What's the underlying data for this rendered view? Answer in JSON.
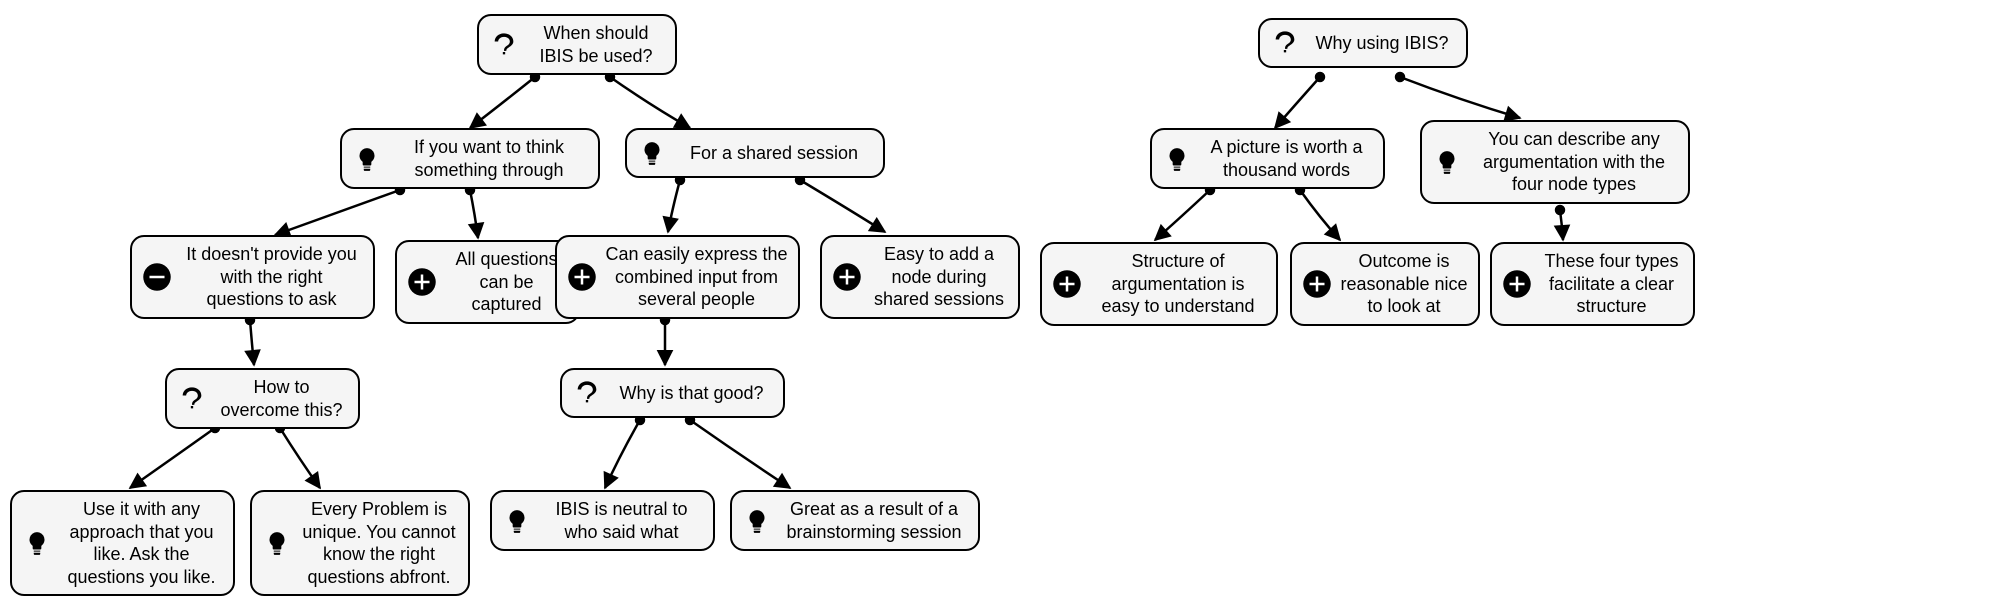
{
  "icons": {
    "question": "question-icon",
    "idea": "lightbulb-icon",
    "plus": "plus-icon",
    "minus": "minus-icon"
  },
  "nodes": {
    "q_when": {
      "icon": "question",
      "text": "When should IBIS be used?"
    },
    "i_think": {
      "icon": "idea",
      "text": "If you want to think something through"
    },
    "i_shared": {
      "icon": "idea",
      "text": "For a shared session"
    },
    "m_noq": {
      "icon": "minus",
      "text": "It doesn't provide you with the right questions to ask"
    },
    "p_allq": {
      "icon": "plus",
      "text": "All questions can be captured"
    },
    "p_combine": {
      "icon": "plus",
      "text": "Can easily express the combined input from several people"
    },
    "p_addnode": {
      "icon": "plus",
      "text": "Easy to add a node during shared sessions"
    },
    "q_overcome": {
      "icon": "question",
      "text": "How to overcome this?"
    },
    "i_anyappr": {
      "icon": "idea",
      "text": "Use it with any approach that you like. Ask the questions you like."
    },
    "i_unique": {
      "icon": "idea",
      "text": "Every Problem is unique. You cannot know the right questions abfront."
    },
    "q_whygood": {
      "icon": "question",
      "text": "Why is that good?"
    },
    "i_neutral": {
      "icon": "idea",
      "text": "IBIS is neutral to who said what"
    },
    "i_brain": {
      "icon": "idea",
      "text": "Great as a result of a brainstorming session"
    },
    "q_whyibis": {
      "icon": "question",
      "text": "Why using IBIS?"
    },
    "i_picture": {
      "icon": "idea",
      "text": "A picture is worth a thousand words"
    },
    "i_fourtypes": {
      "icon": "idea",
      "text": "You can describe any argumentation with the four node types"
    },
    "p_struct": {
      "icon": "plus",
      "text": "Structure of argumentation is easy to understand"
    },
    "p_outcome": {
      "icon": "plus",
      "text": "Outcome is reasonable nice to look at"
    },
    "p_clear": {
      "icon": "plus",
      "text": "These four types facilitate a clear structure"
    }
  }
}
